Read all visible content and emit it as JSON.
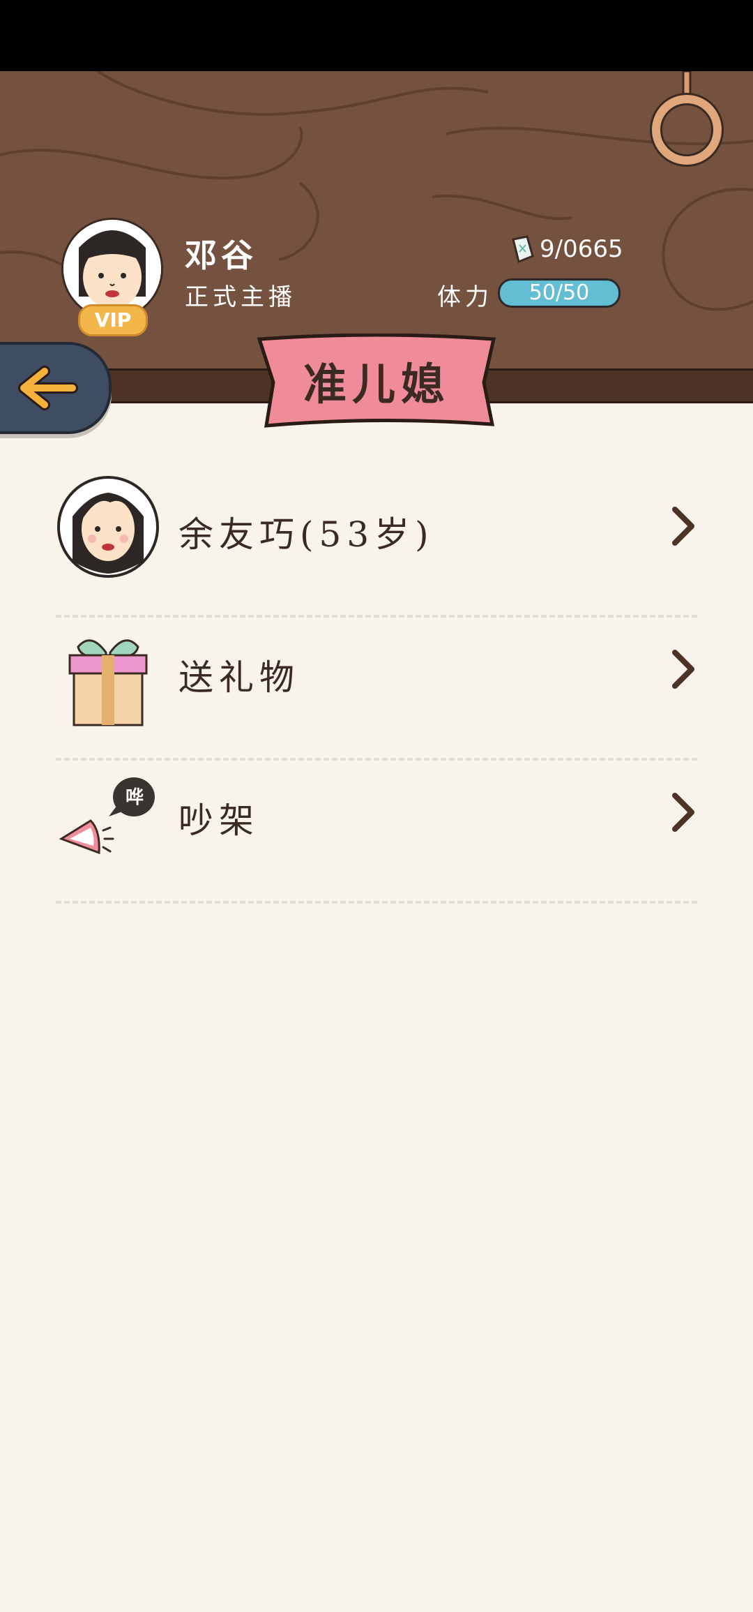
{
  "status_bar": {},
  "user": {
    "name": "邓谷",
    "title": "正式主播",
    "vip_label": "VIP",
    "coins": "9/0665",
    "stamina_label": "体力",
    "stamina_value": "50/50"
  },
  "page": {
    "title": "准儿媳"
  },
  "menu": {
    "items": [
      {
        "label": "余友巧(53岁)",
        "icon": "woman-avatar-icon"
      },
      {
        "label": "送礼物",
        "icon": "gift-box-icon"
      },
      {
        "label": "吵架",
        "icon": "shouting-mouth-icon",
        "bubble_text": "哗"
      }
    ]
  },
  "colors": {
    "header_brown": "#75523f",
    "banner_pink": "#f08c99",
    "stamina_blue": "#63bdd3",
    "back_button": "#3f4d63",
    "arrow_yellow": "#f4b13c",
    "page_bg": "#f8f3eb"
  }
}
